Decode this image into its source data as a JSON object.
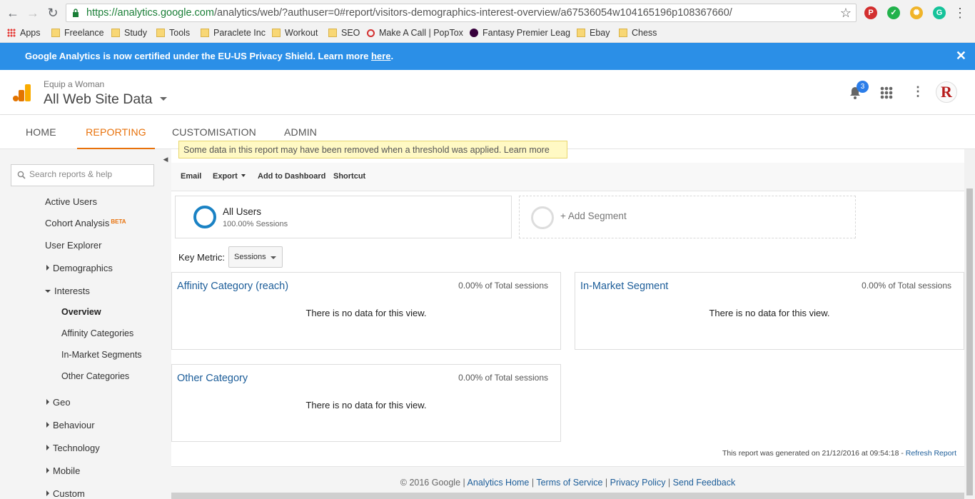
{
  "browser": {
    "url_host": "https://analytics.google.com",
    "url_path": "/analytics/web/?authuser=0#report/visitors-demographics-interest-overview/a67536054w104165196p108367660/",
    "bookmarks": [
      "Apps",
      "Freelance",
      "Study",
      "Tools",
      "Paraclete Inc",
      "Workout",
      "SEO",
      "Make A Call | PopTox",
      "Fantasy Premier Leag",
      "Ebay",
      "Chess"
    ]
  },
  "notice": {
    "text": "Google Analytics is now certified under the EU-US Privacy Shield. Learn more ",
    "link": "here",
    "suffix": ".",
    "close": "✕"
  },
  "header": {
    "account": "Equip a Woman",
    "view": "All Web Site Data",
    "notification_count": "3",
    "avatar_letter": "R"
  },
  "tabs": [
    "HOME",
    "REPORTING",
    "CUSTOMISATION",
    "ADMIN"
  ],
  "sidebar": {
    "search_placeholder": "Search reports & help",
    "collapse_glyph": "◀",
    "items": {
      "active_users": "Active Users",
      "cohort": "Cohort Analysis",
      "cohort_badge": "BETA",
      "user_explorer": "User Explorer",
      "demographics": "Demographics",
      "interests": "Interests",
      "overview": "Overview",
      "affinity": "Affinity Categories",
      "in_market": "In-Market Segments",
      "other": "Other Categories",
      "geo": "Geo",
      "behaviour": "Behaviour",
      "technology": "Technology",
      "mobile": "Mobile",
      "custom": "Custom"
    }
  },
  "report": {
    "threshold_notice": "Some data in this report may have been removed when a threshold was applied. Learn more",
    "toolbar": {
      "email": "Email",
      "export": "Export",
      "add_dashboard": "Add to Dashboard",
      "shortcut": "Shortcut"
    },
    "segment": {
      "name": "All Users",
      "detail": "100.00% Sessions",
      "add": "+ Add Segment"
    },
    "key_metric": {
      "label": "Key Metric:",
      "value": "Sessions"
    },
    "panels": {
      "affinity": {
        "title": "Affinity Category (reach)",
        "pct": "0.00% of Total sessions",
        "empty": "There is no data for this view."
      },
      "in_market": {
        "title": "In-Market Segment",
        "pct": "0.00% of Total sessions",
        "empty": "There is no data for this view."
      },
      "other": {
        "title": "Other Category",
        "pct": "0.00% of Total sessions",
        "empty": "There is no data for this view."
      }
    },
    "generated": "This report was generated on 21/12/2016 at 09:54:18 - ",
    "refresh": "Refresh Report"
  },
  "footer": {
    "copyright": "© 2016 Google | ",
    "analytics_home": "Analytics Home",
    "sep": " | ",
    "terms": "Terms of Service",
    "privacy": "Privacy Policy",
    "feedback": "Send Feedback"
  },
  "colors": {
    "notice_blue": "#2b8fe7",
    "reporting_orange": "#e8710a",
    "link_blue": "#1c5d99",
    "segment_ring": "#1a82c4"
  }
}
